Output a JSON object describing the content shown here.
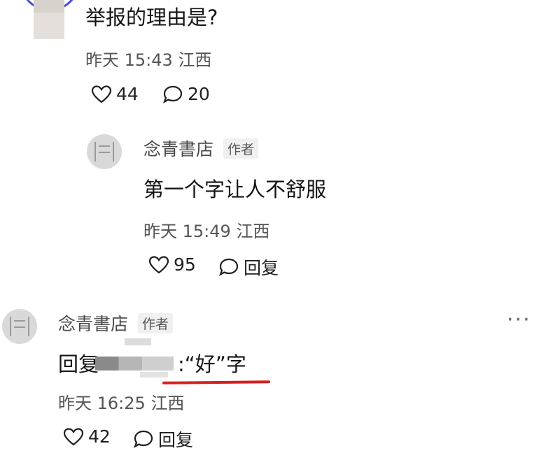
{
  "comment_top": {
    "text": "举报的理由是?",
    "time": "昨天 15:43",
    "location": "江西",
    "likes": "44",
    "replies": "20"
  },
  "reply_1": {
    "user": "念青書店",
    "tag": "作者",
    "text": "第一个字让人不舒服",
    "time": "昨天 15:49",
    "location": "江西",
    "likes": "95",
    "reply_label": "回复"
  },
  "reply_2": {
    "user": "念青書店",
    "tag": "作者",
    "reply_prefix": "回复",
    "reply_suffix": ":“好”字",
    "time": "昨天 16:25",
    "location": "江西",
    "likes": "42",
    "reply_label": "回复",
    "more": "···"
  },
  "colors": {
    "underline": "#d81e1e",
    "avatar_ring": "#4b4bd6"
  }
}
